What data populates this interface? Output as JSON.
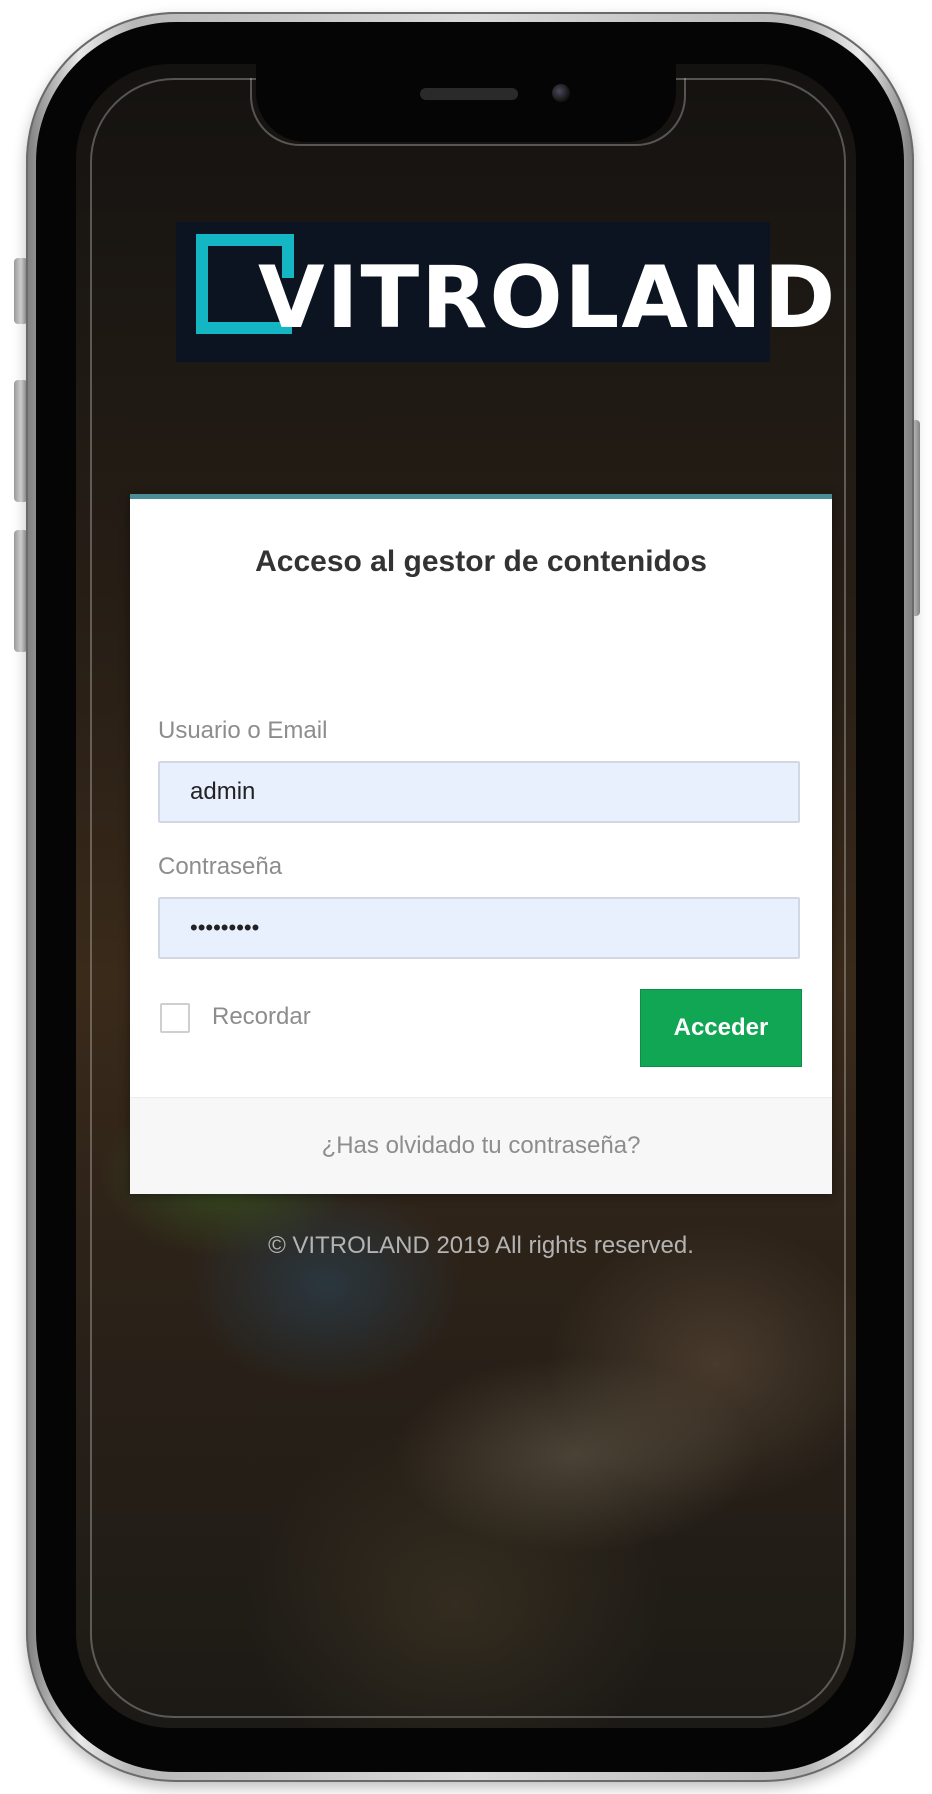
{
  "brand": {
    "logo_text": "VITROLAND",
    "accent_color": "#14b6c4",
    "logo_bg": "#0c1422"
  },
  "login": {
    "title": "Acceso al gestor de contenidos",
    "username": {
      "label": "Usuario o Email",
      "value": "admin"
    },
    "password": {
      "label": "Contraseña",
      "masked_value": "•••••••••"
    },
    "remember_label": "Recordar",
    "remember_checked": false,
    "submit_label": "Acceder",
    "submit_color": "#11a653",
    "forgot_link": "¿Has olvidado tu contraseña?"
  },
  "footer": {
    "copyright": "© VITROLAND 2019 All rights reserved."
  },
  "icons": {
    "camera": "front-camera-icon",
    "speaker": "earpiece-speaker-icon"
  }
}
